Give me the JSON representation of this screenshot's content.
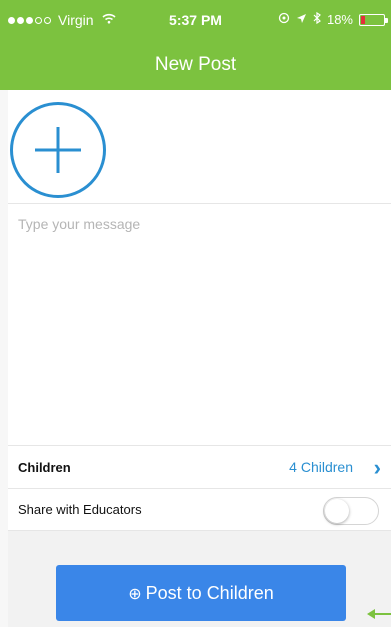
{
  "status_bar": {
    "carrier": "Virgin",
    "time": "5:37 PM",
    "battery": "18%"
  },
  "nav": {
    "title": "New Post"
  },
  "composer": {
    "add_media_icon": "plus-circle-icon",
    "message_placeholder": "Type your message",
    "message_value": ""
  },
  "settings": {
    "children_label": "Children",
    "children_value": "4 Children",
    "share_label": "Share with Educators",
    "share_enabled": false
  },
  "actions": {
    "post_label": "Post to Children",
    "post_icon": "plus-circle-icon"
  },
  "colors": {
    "header": "#7cc23f",
    "accent": "#2a8fd1",
    "button": "#3a86e8",
    "battery_low": "#e3303b",
    "annotation_arrow": "#7cc23f"
  }
}
